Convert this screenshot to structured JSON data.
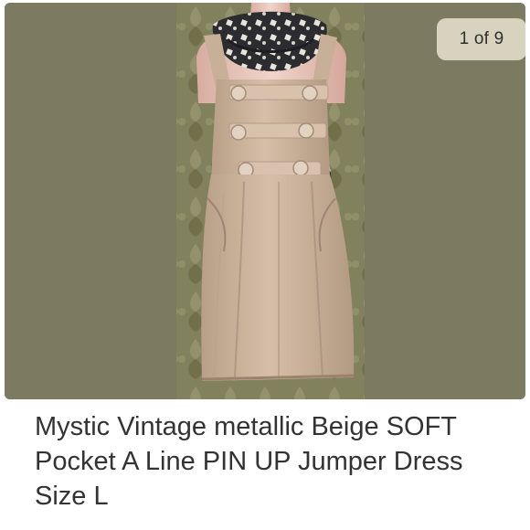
{
  "listing": {
    "photo_counter": "1 of 9",
    "title": "Mystic Vintage metallic Beige SOFT Pocket A Line PIN UP Jumper Dress Size L"
  },
  "photo": {
    "subject": "beige-jumper-dress-on-mannequin",
    "colors": {
      "background_olive": "#7d7a62",
      "wallpaper_green": "#8d8c66",
      "dress_beige": "#cdb49d",
      "mannequin_skin": "#e7c6bb",
      "scarf_black": "#2a2a2e"
    }
  }
}
